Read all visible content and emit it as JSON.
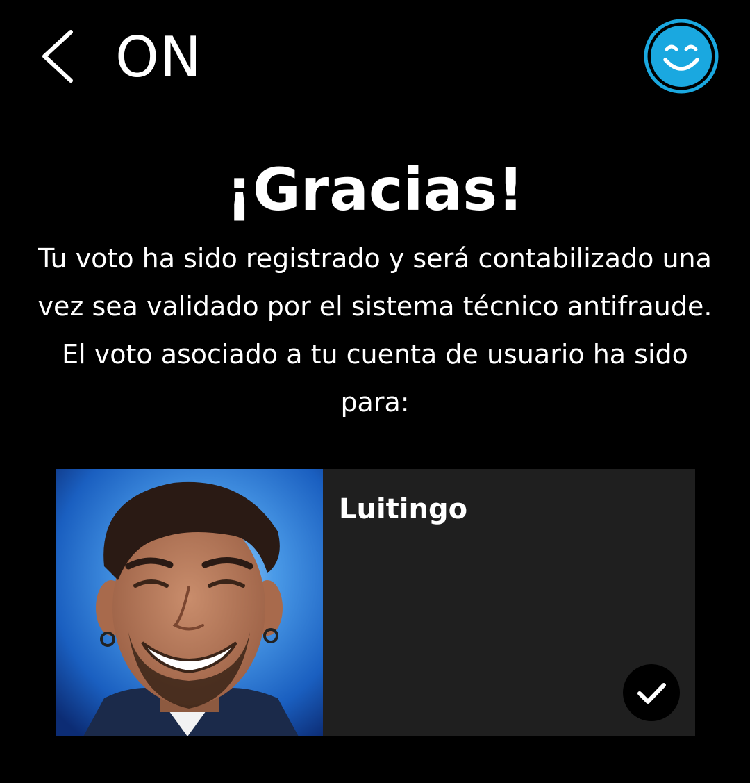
{
  "header": {
    "title": "ON",
    "back_icon": "chevron-left-icon",
    "profile_icon": "smiley-face-icon",
    "accent_color": "#1aa8e0"
  },
  "main": {
    "headline": "¡Gracias!",
    "message": "Tu voto ha sido registrado y será contabilizado una vez sea validado por el sistema técnico antifraude. El voto asociado a tu cuenta de usuario ha sido para:"
  },
  "candidate": {
    "name": "Luitingo",
    "selected": true,
    "selected_icon": "checkmark-icon"
  }
}
